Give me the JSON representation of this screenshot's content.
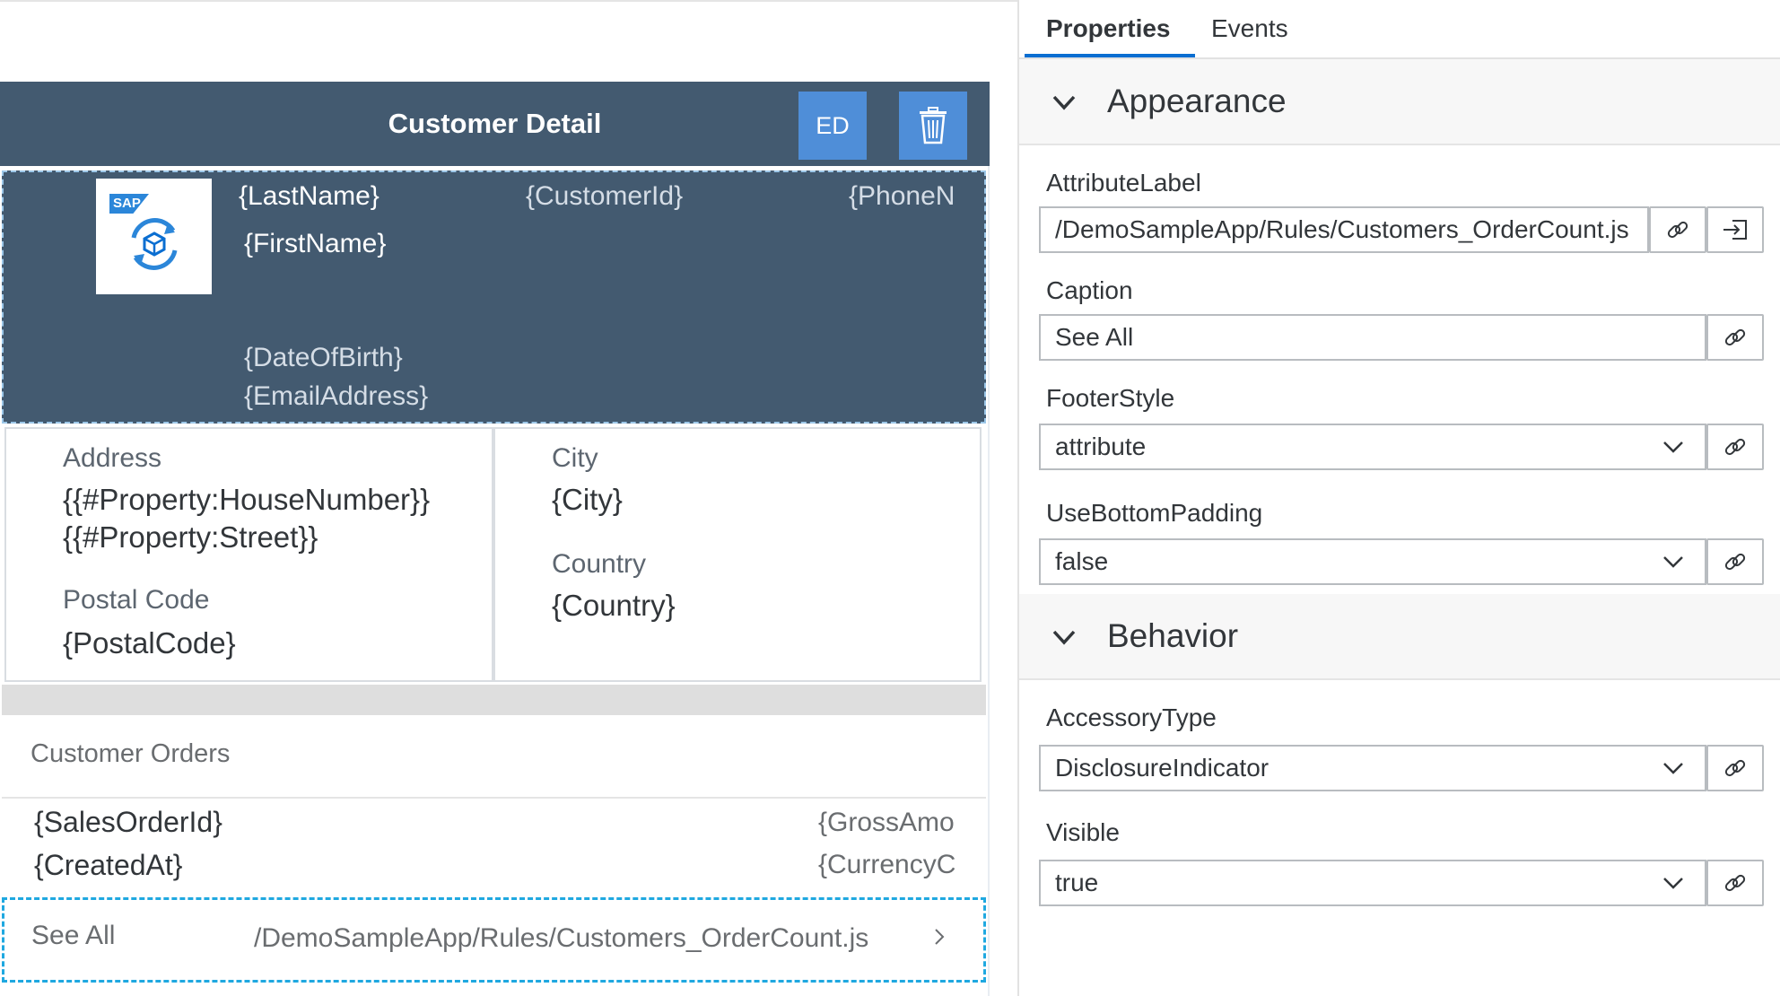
{
  "canvas": {
    "header": {
      "title": "Customer Detail",
      "edit_label": "ED"
    },
    "object_header": {
      "logo_text": "SAP",
      "last_name": "{LastName}",
      "customer_id": "{CustomerId}",
      "phone": "{PhoneN",
      "first_name": "{FirstName}",
      "date_of_birth": "{DateOfBirth}",
      "email": "{EmailAddress}"
    },
    "key_values": {
      "address_label": "Address",
      "address_line1": "{{#Property:HouseNumber}}",
      "address_line2": "{{#Property:Street}}",
      "postal_label": "Postal Code",
      "postal_value": "{PostalCode}",
      "city_label": "City",
      "city_value": "{City}",
      "country_label": "Country",
      "country_value": "{Country}"
    },
    "orders": {
      "title": "Customer Orders",
      "sales_order_id": "{SalesOrderId}",
      "created_at": "{CreatedAt}",
      "gross_amount": "{GrossAmo",
      "currency": "{CurrencyC"
    },
    "footer": {
      "caption": "See All",
      "attribute": "/DemoSampleApp/Rules/Customers_OrderCount.js"
    }
  },
  "panel": {
    "tabs": [
      {
        "label": "Properties",
        "active": true
      },
      {
        "label": "Events",
        "active": false
      }
    ],
    "appearance": {
      "title": "Appearance",
      "attribute_label": {
        "label": "AttributeLabel",
        "value": "/DemoSampleApp/Rules/Customers_OrderCount.js"
      },
      "caption": {
        "label": "Caption",
        "value": "See All"
      },
      "footer_style": {
        "label": "FooterStyle",
        "value": "attribute"
      },
      "use_bottom_padding": {
        "label": "UseBottomPadding",
        "value": "false"
      }
    },
    "behavior": {
      "title": "Behavior",
      "accessory_type": {
        "label": "AccessoryType",
        "value": "DisclosureIndicator"
      },
      "visible": {
        "label": "Visible",
        "value": "true"
      }
    }
  },
  "colors": {
    "header_bg": "#435a70",
    "button_blue": "#4f8ed8",
    "selection_dash": "#1fa8e0",
    "active_tab": "#0a6ed1"
  },
  "icons": {
    "delete": "trash-icon",
    "bind": "link-icon",
    "open": "open-in-icon",
    "expand": "chevron-down-icon",
    "disclosure": "chevron-right-icon",
    "logo": "sync-cube-icon"
  }
}
